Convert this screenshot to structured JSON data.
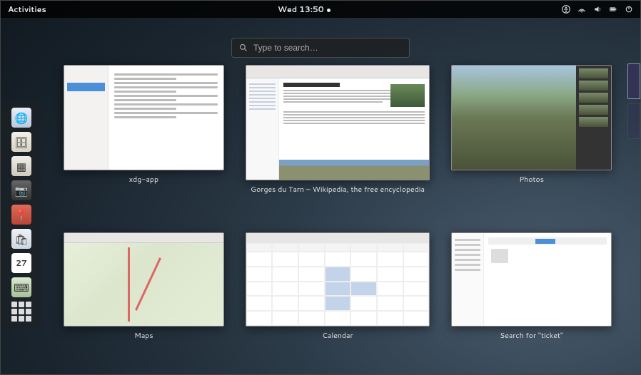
{
  "topbar": {
    "activities": "Activities",
    "clock": "Wed 13:50",
    "status_icons": [
      "accessibility-icon",
      "network-icon",
      "volume-icon",
      "battery-icon",
      "power-icon"
    ]
  },
  "search": {
    "placeholder": "Type to search…"
  },
  "dash": {
    "apps": [
      {
        "name": "web-browser",
        "bg": "linear-gradient(#e8eef5,#b9c8da)",
        "glyph": "🌐"
      },
      {
        "name": "files",
        "bg": "linear-gradient(#f4f0e8,#d8d2c4)",
        "glyph": "🗄"
      },
      {
        "name": "media-player",
        "bg": "linear-gradient(#f0eee8,#cfcabd)",
        "glyph": "▦"
      },
      {
        "name": "camera",
        "bg": "linear-gradient(#666,#333)",
        "glyph": "📷"
      },
      {
        "name": "maps",
        "bg": "linear-gradient(#e16a5a,#b84535)",
        "glyph": "📍"
      },
      {
        "name": "software",
        "bg": "linear-gradient(#eef2f6,#cdd6e0)",
        "glyph": "🛍"
      },
      {
        "name": "calendar",
        "bg": "#fff",
        "glyph": "27"
      },
      {
        "name": "terminal",
        "bg": "linear-gradient(#d9e8d2,#a8c098)",
        "glyph": "⌨"
      }
    ],
    "show_apps": "Show Applications"
  },
  "windows": [
    {
      "id": "xdg",
      "label": "xdg-app"
    },
    {
      "id": "wiki",
      "label": "Gorges du Tarn – Wikipedia, the free encyclopedia",
      "article_title": "Gorges du Tarn"
    },
    {
      "id": "photos",
      "label": "Photos"
    },
    {
      "id": "maps",
      "label": "Maps"
    },
    {
      "id": "cal",
      "label": "Calendar"
    },
    {
      "id": "search",
      "label": "Search for \"ticket\""
    }
  ],
  "calendar_day": "27"
}
